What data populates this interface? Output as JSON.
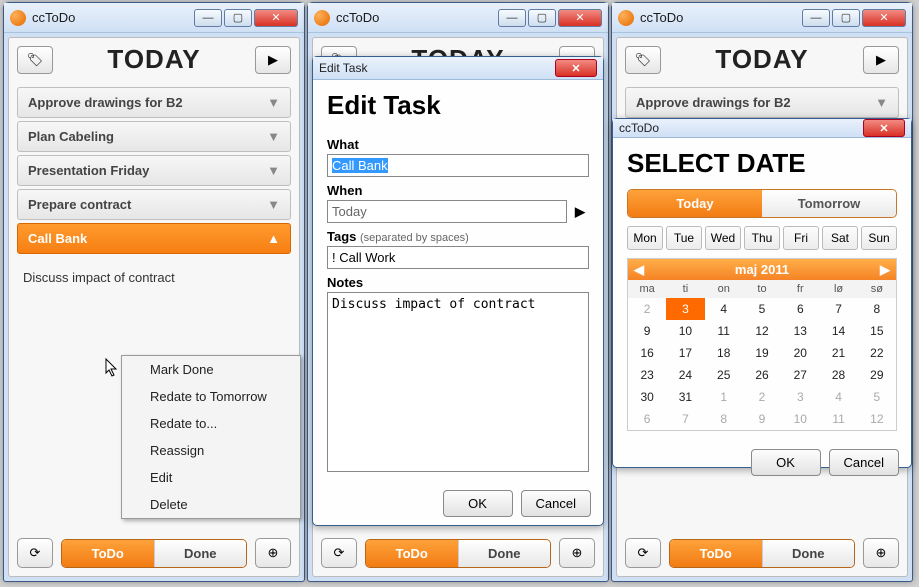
{
  "app_title": "ccToDo",
  "header": "TODAY",
  "tasks": [
    {
      "label": "Approve drawings for B2",
      "active": false
    },
    {
      "label": "Plan Cabeling",
      "active": false
    },
    {
      "label": "Presentation Friday",
      "active": false
    },
    {
      "label": "Prepare contract",
      "active": false
    },
    {
      "label": "Call Bank",
      "active": true
    }
  ],
  "task_detail": "Discuss impact of contract",
  "bottom": {
    "todo": "ToDo",
    "done": "Done"
  },
  "context_menu": {
    "items": [
      "Mark Done",
      "Redate to Tomorrow",
      "Redate to...",
      "Reassign",
      "Edit",
      "Delete"
    ]
  },
  "edit_dialog": {
    "title": "Edit Task",
    "heading": "Edit Task",
    "labels": {
      "what": "What",
      "when": "When",
      "tags": "Tags",
      "tags_hint": "(separated by spaces)",
      "notes": "Notes"
    },
    "what_value": "Call Bank",
    "when_value": "Today",
    "tags_value": "! Call Work",
    "notes_value": "Discuss impact of contract",
    "ok": "OK",
    "cancel": "Cancel"
  },
  "date_dialog": {
    "title": "ccToDo",
    "heading": "SELECT DATE",
    "today": "Today",
    "tomorrow": "Tomorrow",
    "days": [
      "Mon",
      "Tue",
      "Wed",
      "Thu",
      "Fri",
      "Sat",
      "Sun"
    ],
    "month": "maj 2011",
    "dow": [
      "ma",
      "ti",
      "on",
      "to",
      "fr",
      "lø",
      "sø"
    ],
    "weeks": [
      [
        {
          "n": 2,
          "dim": true
        },
        {
          "n": 3,
          "sel": true
        },
        {
          "n": 4
        },
        {
          "n": 5
        },
        {
          "n": 6
        },
        {
          "n": 7
        },
        {
          "n": 8
        }
      ],
      [
        {
          "n": 9
        },
        {
          "n": 10
        },
        {
          "n": 11
        },
        {
          "n": 12
        },
        {
          "n": 13
        },
        {
          "n": 14
        },
        {
          "n": 15
        }
      ],
      [
        {
          "n": 16
        },
        {
          "n": 17
        },
        {
          "n": 18
        },
        {
          "n": 19
        },
        {
          "n": 20
        },
        {
          "n": 21
        },
        {
          "n": 22
        }
      ],
      [
        {
          "n": 23
        },
        {
          "n": 24
        },
        {
          "n": 25
        },
        {
          "n": 26
        },
        {
          "n": 27
        },
        {
          "n": 28
        },
        {
          "n": 29
        }
      ],
      [
        {
          "n": 30
        },
        {
          "n": 31
        },
        {
          "n": 1,
          "dim": true
        },
        {
          "n": 2,
          "dim": true
        },
        {
          "n": 3,
          "dim": true
        },
        {
          "n": 4,
          "dim": true
        },
        {
          "n": 5,
          "dim": true
        }
      ],
      [
        {
          "n": 6,
          "dim": true
        },
        {
          "n": 7,
          "dim": true
        },
        {
          "n": 8,
          "dim": true
        },
        {
          "n": 9,
          "dim": true
        },
        {
          "n": 10,
          "dim": true
        },
        {
          "n": 11,
          "dim": true
        },
        {
          "n": 12,
          "dim": true
        }
      ]
    ],
    "ok": "OK",
    "cancel": "Cancel"
  },
  "window3_tasks": [
    {
      "label": "Approve drawings for B2",
      "active": false
    }
  ]
}
